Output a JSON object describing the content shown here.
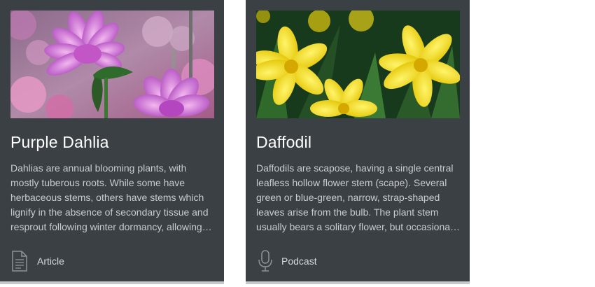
{
  "cards": [
    {
      "title": "Purple Dahlia",
      "description": "Dahlias are annual blooming plants, with mostly tuberous roots. While some have herbaceous stems, others have stems which lignify in the absence of secondary tissue and resprout following winter dormancy, allowing further seasons of growth.",
      "type_label": "Article",
      "type_icon": "document-icon"
    },
    {
      "title": "Daffodil",
      "description": "Daffodils are scapose, having a single central leafless hollow flower stem (scape). Several green or blue-green, narrow, strap-shaped leaves arise from the bulb. The plant stem usually bears a solitary flower, but occasionally a cluster of flowers.",
      "type_label": "Podcast",
      "type_icon": "microphone-icon"
    }
  ],
  "colors": {
    "card_background": "#3b4044",
    "title_text": "#ffffff",
    "body_text": "#c9ccce",
    "card_bottom_border": "#c7cacc"
  }
}
